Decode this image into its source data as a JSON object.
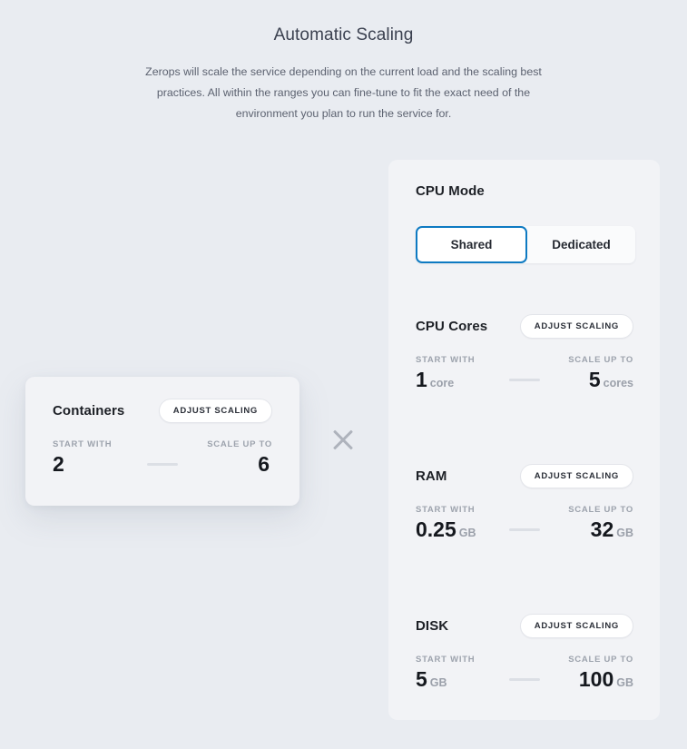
{
  "header": {
    "title": "Automatic Scaling",
    "description": "Zerops will scale the service depending on the current load and the scaling best practices. All within the ranges you can fine-tune to fit the exact need of the environment you plan to run the service for."
  },
  "cpu_mode": {
    "title": "CPU Mode",
    "options": [
      {
        "label": "Shared",
        "selected": true
      },
      {
        "label": "Dedicated",
        "selected": false
      }
    ],
    "selected": "Shared",
    "accent_color": "#0e7ac2"
  },
  "labels": {
    "start_with": "START WITH",
    "scale_up_to": "SCALE UP TO",
    "adjust_scaling": "ADJUST SCALING"
  },
  "containers": {
    "title": "Containers",
    "adjust_label": "ADJUST SCALING",
    "start_label": "START WITH",
    "start_value": "2",
    "start_unit": "",
    "end_label": "SCALE UP TO",
    "end_value": "6",
    "end_unit": ""
  },
  "multiply_icon": "multiply-icon",
  "resources": [
    {
      "key": "cpu_cores",
      "title": "CPU Cores",
      "adjust_label": "ADJUST SCALING",
      "start_label": "START WITH",
      "start_value": "1",
      "start_unit": "core",
      "end_label": "SCALE UP TO",
      "end_value": "5",
      "end_unit": "cores"
    },
    {
      "key": "ram",
      "title": "RAM",
      "adjust_label": "ADJUST SCALING",
      "start_label": "START WITH",
      "start_value": "0.25",
      "start_unit": "GB",
      "end_label": "SCALE UP TO",
      "end_value": "32",
      "end_unit": "GB"
    },
    {
      "key": "disk",
      "title": "DISK",
      "adjust_label": "ADJUST SCALING",
      "start_label": "START WITH",
      "start_value": "5",
      "start_unit": "GB",
      "end_label": "SCALE UP TO",
      "end_value": "100",
      "end_unit": "GB"
    }
  ],
  "colors": {
    "page_background": "#e9ecf1",
    "panel_background": "#f2f3f6",
    "accent": "#0e7ac2",
    "muted_text": "#9da3ad",
    "value_text": "#15181e"
  }
}
